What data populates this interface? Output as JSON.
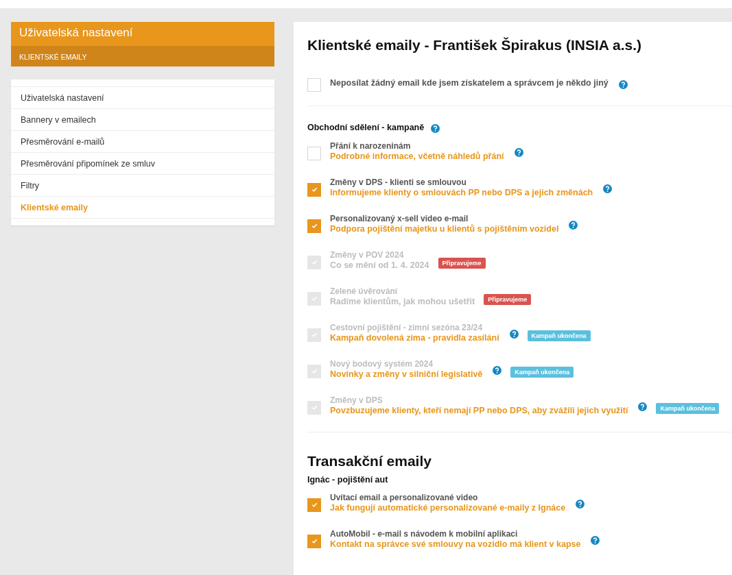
{
  "sidebar": {
    "title": "Uživatelská nastavení",
    "subtitle": "KLIENTSKÉ EMAILY",
    "items": [
      {
        "label": "Uživatelská nastavení",
        "selected": false
      },
      {
        "label": "Bannery v emailech",
        "selected": false
      },
      {
        "label": "Přesměrování e-mailů",
        "selected": false
      },
      {
        "label": "Přesměrování připomínek ze smluv",
        "selected": false
      },
      {
        "label": "Filtry",
        "selected": false
      },
      {
        "label": "Klientské emaily",
        "selected": true
      }
    ]
  },
  "main": {
    "title": "Klientské emaily - František Špirakus (INSIA a.s.)",
    "global_option": {
      "label": "Neposílat žádný email kde jsem získatelem a správcem je někdo jiný",
      "checked": false,
      "help": true
    },
    "campaigns": {
      "heading": "Obchodní sdělení - kampaně",
      "help": true,
      "items": [
        {
          "title": "Přání k narozeninám",
          "subtitle": "Podrobné informace, včetně náhledů přání",
          "link": true,
          "checked": false,
          "disabled": false,
          "help": true
        },
        {
          "title": "Změny v DPS - klienti se smlouvou",
          "subtitle": "Informujeme klienty o smlouvách PP nebo DPS a jejich změnách",
          "link": true,
          "checked": true,
          "disabled": false,
          "help": true
        },
        {
          "title": "Personalizovaný x-sell video e-mail",
          "subtitle": "Podpora pojištění majetku u klientů s pojištěním vozidel",
          "link": true,
          "checked": true,
          "disabled": false,
          "help": true
        },
        {
          "title": "Změny v POV 2024",
          "subtitle": "Co se mění od 1. 4. 2024",
          "link": false,
          "checked": true,
          "disabled": true,
          "help": false,
          "badge": {
            "text": "Připravujeme",
            "kind": "upcoming"
          }
        },
        {
          "title": "Zelené úvěrování",
          "subtitle": "Radíme klientům, jak mohou ušetřit",
          "link": false,
          "checked": true,
          "disabled": true,
          "help": false,
          "badge": {
            "text": "Připravujeme",
            "kind": "upcoming"
          }
        },
        {
          "title": "Cestovní pojištění - zimní sezóna 23/24",
          "subtitle": "Kampaň dovolená zima - pravidla zasílání",
          "link": true,
          "checked": true,
          "disabled": true,
          "help": true,
          "badge": {
            "text": "Kampaň ukončena",
            "kind": "ended"
          }
        },
        {
          "title": "Nový bodový systém 2024",
          "subtitle": "Novinky a změny v silniční legislativě",
          "link": true,
          "checked": true,
          "disabled": true,
          "help": true,
          "badge": {
            "text": "Kampaň ukončena",
            "kind": "ended"
          }
        },
        {
          "title": "Změny v DPS",
          "subtitle": "Povzbuzujeme klienty, kteří nemají PP nebo DPS, aby zvážili jejich využití",
          "link": true,
          "checked": true,
          "disabled": true,
          "help": true,
          "badge": {
            "text": "Kampaň ukončena",
            "kind": "ended"
          }
        }
      ]
    },
    "transactional": {
      "heading": "Transakční emaily",
      "group": "Ignác - pojištění aut",
      "items": [
        {
          "title": "Uvítací email a personalizované video",
          "subtitle": "Jak fungují automatické personalizované e-maily z Ignáce",
          "link": true,
          "checked": true,
          "disabled": false,
          "help": true
        },
        {
          "title": "AutoMobil - e-mail s návodem k mobilní aplikaci",
          "subtitle": "Kontakt na správce své smlouvy na vozidlo má klient v kapse",
          "link": true,
          "checked": true,
          "disabled": false,
          "help": true
        }
      ]
    }
  }
}
